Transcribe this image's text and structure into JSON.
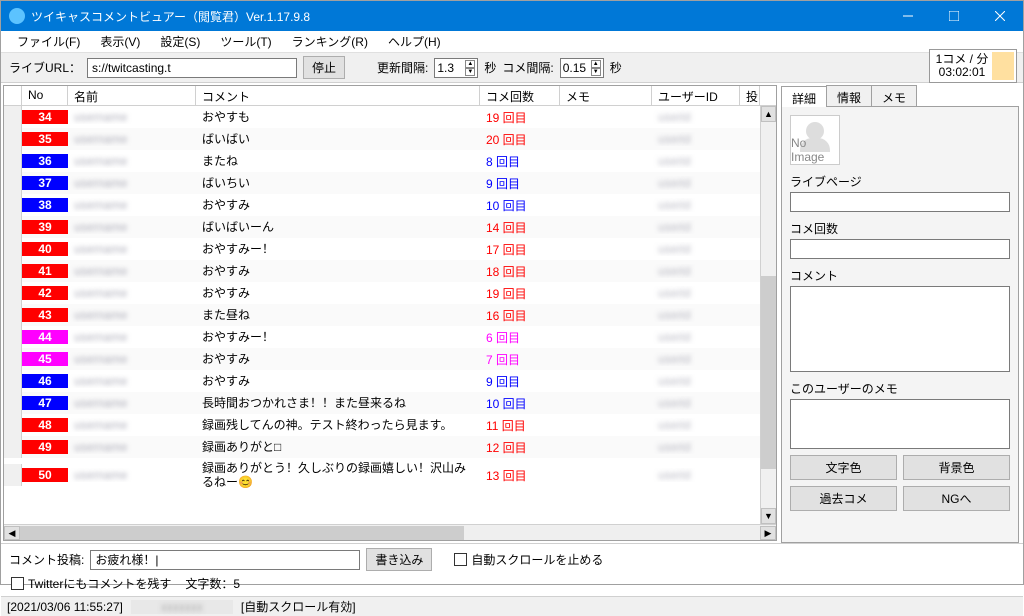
{
  "window": {
    "title": "ツイキャスコメントビュアー（閲覧君）Ver.1.17.9.8"
  },
  "menu": [
    "ファイル(F)",
    "表示(V)",
    "設定(S)",
    "ツール(T)",
    "ランキング(R)",
    "ヘルプ(H)"
  ],
  "toolbar": {
    "url_label": "ライブURL：",
    "url_value": "s://twitcasting.t",
    "stop": "停止",
    "update_label": "更新間隔:",
    "update_val": "1.3",
    "sec1": "秒",
    "comment_interval_label": "コメ間隔:",
    "comment_interval_val": "0.15",
    "sec2": "秒"
  },
  "status_box": {
    "line1": "1コメ / 分",
    "line2": "03:02:01"
  },
  "columns": {
    "no": "No",
    "name": "名前",
    "comment": "コメント",
    "count": "コメ回数",
    "memo": "メモ",
    "uid": "ユーザーID",
    "last": "投"
  },
  "rows": [
    {
      "no": "34",
      "bg": "#ff0000",
      "comment": "おやすも",
      "count": "19 回目",
      "cc": "#ff0000"
    },
    {
      "no": "35",
      "bg": "#ff0000",
      "comment": "ばいばい",
      "count": "20 回目",
      "cc": "#ff0000"
    },
    {
      "no": "36",
      "bg": "#0000ff",
      "comment": "またね",
      "count": "8 回目",
      "cc": "#0000ff"
    },
    {
      "no": "37",
      "bg": "#0000ff",
      "comment": "ばいちい",
      "count": "9 回目",
      "cc": "#0000ff"
    },
    {
      "no": "38",
      "bg": "#0000ff",
      "comment": "おやすみ",
      "count": "10 回目",
      "cc": "#0000ff"
    },
    {
      "no": "39",
      "bg": "#ff0000",
      "comment": "ばいばいーん",
      "count": "14 回目",
      "cc": "#ff0000"
    },
    {
      "no": "40",
      "bg": "#ff0000",
      "comment": "おやすみー！",
      "count": "17 回目",
      "cc": "#ff0000"
    },
    {
      "no": "41",
      "bg": "#ff0000",
      "comment": "おやすみ",
      "count": "18 回目",
      "cc": "#ff0000"
    },
    {
      "no": "42",
      "bg": "#ff0000",
      "comment": "おやすみ",
      "count": "19 回目",
      "cc": "#ff0000"
    },
    {
      "no": "43",
      "bg": "#ff0000",
      "comment": "また昼ね",
      "count": "16 回目",
      "cc": "#ff0000"
    },
    {
      "no": "44",
      "bg": "#ff00ff",
      "comment": "おやすみー！",
      "count": "6 回目",
      "cc": "#ff00ff"
    },
    {
      "no": "45",
      "bg": "#ff00ff",
      "comment": "おやすみ",
      "count": "7 回目",
      "cc": "#ff00ff"
    },
    {
      "no": "46",
      "bg": "#0000ff",
      "comment": "おやすみ",
      "count": "9 回目",
      "cc": "#0000ff"
    },
    {
      "no": "47",
      "bg": "#0000ff",
      "comment": "長時間おつかれさま！！また昼来るね",
      "count": "10 回目",
      "cc": "#0000ff"
    },
    {
      "no": "48",
      "bg": "#ff0000",
      "comment": "録画残してんの神。テスト終わったら見ます。",
      "count": "11 回目",
      "cc": "#ff0000"
    },
    {
      "no": "49",
      "bg": "#ff0000",
      "comment": "録画ありがと□",
      "count": "12 回目",
      "cc": "#ff0000"
    },
    {
      "no": "50",
      "bg": "#ff0000",
      "comment": "録画ありがとう！久しぶりの録画嬉しい！沢山みるねー😊",
      "count": "13 回目",
      "cc": "#ff0000",
      "tall": true
    }
  ],
  "side": {
    "tabs": [
      "詳細",
      "情報",
      "メモ"
    ],
    "avatar_text": "No Image",
    "livepage": "ライブページ",
    "count": "コメ回数",
    "comment": "コメント",
    "usermemo": "このユーザーのメモ",
    "btns": [
      "文字色",
      "背景色",
      "過去コメ",
      "NGへ"
    ]
  },
  "bottom": {
    "post_label": "コメント投稿:",
    "post_value": "お疲れ様！|",
    "write": "書き込み",
    "stop_scroll": "自動スクロールを止める",
    "twitter": "Twitterにもコメントを残す",
    "charcount_label": "文字数：5"
  },
  "statusbar": {
    "time": "[2021/03/06 11:55:27]",
    "scroll": "[自動スクロール有効]"
  }
}
